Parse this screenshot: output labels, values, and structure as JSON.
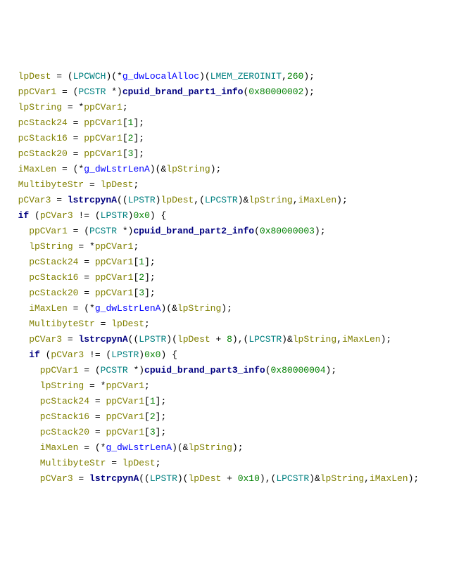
{
  "lines": [
    [
      {
        "t": "  lpDest ",
        "c": "olive"
      },
      {
        "t": "= (",
        "c": "black"
      },
      {
        "t": "LPCWCH",
        "c": "teal"
      },
      {
        "t": ")(*",
        "c": "black"
      },
      {
        "t": "g_dwLocalAlloc",
        "c": "blue"
      },
      {
        "t": ")(",
        "c": "black"
      },
      {
        "t": "LMEM_ZEROINIT",
        "c": "teal"
      },
      {
        "t": ",",
        "c": "black"
      },
      {
        "t": "260",
        "c": "green"
      },
      {
        "t": ");",
        "c": "black"
      }
    ],
    [
      {
        "t": "  ppCVar1 ",
        "c": "olive"
      },
      {
        "t": "= (",
        "c": "black"
      },
      {
        "t": "PCSTR ",
        "c": "teal"
      },
      {
        "t": "*)",
        "c": "black"
      },
      {
        "t": "cpuid_brand_part1_info",
        "c": "navy"
      },
      {
        "t": "(",
        "c": "black"
      },
      {
        "t": "0x80000002",
        "c": "green"
      },
      {
        "t": ");",
        "c": "black"
      }
    ],
    [
      {
        "t": "  lpString ",
        "c": "olive"
      },
      {
        "t": "= *",
        "c": "black"
      },
      {
        "t": "ppCVar1",
        "c": "olive"
      },
      {
        "t": ";",
        "c": "black"
      }
    ],
    [
      {
        "t": "  pcStack24 ",
        "c": "olive"
      },
      {
        "t": "= ",
        "c": "black"
      },
      {
        "t": "ppCVar1",
        "c": "olive"
      },
      {
        "t": "[",
        "c": "black"
      },
      {
        "t": "1",
        "c": "green"
      },
      {
        "t": "];",
        "c": "black"
      }
    ],
    [
      {
        "t": "  pcStack16 ",
        "c": "olive"
      },
      {
        "t": "= ",
        "c": "black"
      },
      {
        "t": "ppCVar1",
        "c": "olive"
      },
      {
        "t": "[",
        "c": "black"
      },
      {
        "t": "2",
        "c": "green"
      },
      {
        "t": "];",
        "c": "black"
      }
    ],
    [
      {
        "t": "  pcStack20 ",
        "c": "olive"
      },
      {
        "t": "= ",
        "c": "black"
      },
      {
        "t": "ppCVar1",
        "c": "olive"
      },
      {
        "t": "[",
        "c": "black"
      },
      {
        "t": "3",
        "c": "green"
      },
      {
        "t": "];",
        "c": "black"
      }
    ],
    [
      {
        "t": "  iMaxLen ",
        "c": "olive"
      },
      {
        "t": "= (*",
        "c": "black"
      },
      {
        "t": "g_dwLstrLenA",
        "c": "blue"
      },
      {
        "t": ")(&",
        "c": "black"
      },
      {
        "t": "lpString",
        "c": "olive"
      },
      {
        "t": ");",
        "c": "black"
      }
    ],
    [
      {
        "t": "  MultibyteStr ",
        "c": "olive"
      },
      {
        "t": "= ",
        "c": "black"
      },
      {
        "t": "lpDest",
        "c": "olive"
      },
      {
        "t": ";",
        "c": "black"
      }
    ],
    [
      {
        "t": "  pCVar3 ",
        "c": "olive"
      },
      {
        "t": "= ",
        "c": "black"
      },
      {
        "t": "lstrcpynA",
        "c": "navy"
      },
      {
        "t": "((",
        "c": "black"
      },
      {
        "t": "LPSTR",
        "c": "teal"
      },
      {
        "t": ")",
        "c": "black"
      },
      {
        "t": "lpDest",
        "c": "olive"
      },
      {
        "t": ",(",
        "c": "black"
      },
      {
        "t": "LPCSTR",
        "c": "teal"
      },
      {
        "t": ")&",
        "c": "black"
      },
      {
        "t": "lpString",
        "c": "olive"
      },
      {
        "t": ",",
        "c": "black"
      },
      {
        "t": "iMaxLen",
        "c": "olive"
      },
      {
        "t": ");",
        "c": "black"
      }
    ],
    [
      {
        "t": "  if ",
        "c": "navy"
      },
      {
        "t": "(",
        "c": "black"
      },
      {
        "t": "pCVar3 ",
        "c": "olive"
      },
      {
        "t": "!= (",
        "c": "black"
      },
      {
        "t": "LPSTR",
        "c": "teal"
      },
      {
        "t": ")",
        "c": "black"
      },
      {
        "t": "0x0",
        "c": "green"
      },
      {
        "t": ") {",
        "c": "black"
      }
    ],
    [
      {
        "t": "    ppCVar1 ",
        "c": "olive"
      },
      {
        "t": "= (",
        "c": "black"
      },
      {
        "t": "PCSTR ",
        "c": "teal"
      },
      {
        "t": "*)",
        "c": "black"
      },
      {
        "t": "cpuid_brand_part2_info",
        "c": "navy"
      },
      {
        "t": "(",
        "c": "black"
      },
      {
        "t": "0x80000003",
        "c": "green"
      },
      {
        "t": ");",
        "c": "black"
      }
    ],
    [
      {
        "t": "    lpString ",
        "c": "olive"
      },
      {
        "t": "= *",
        "c": "black"
      },
      {
        "t": "ppCVar1",
        "c": "olive"
      },
      {
        "t": ";",
        "c": "black"
      }
    ],
    [
      {
        "t": "    pcStack24 ",
        "c": "olive"
      },
      {
        "t": "= ",
        "c": "black"
      },
      {
        "t": "ppCVar1",
        "c": "olive"
      },
      {
        "t": "[",
        "c": "black"
      },
      {
        "t": "1",
        "c": "green"
      },
      {
        "t": "];",
        "c": "black"
      }
    ],
    [
      {
        "t": "    pcStack16 ",
        "c": "olive"
      },
      {
        "t": "= ",
        "c": "black"
      },
      {
        "t": "ppCVar1",
        "c": "olive"
      },
      {
        "t": "[",
        "c": "black"
      },
      {
        "t": "2",
        "c": "green"
      },
      {
        "t": "];",
        "c": "black"
      }
    ],
    [
      {
        "t": "    pcStack20 ",
        "c": "olive"
      },
      {
        "t": "= ",
        "c": "black"
      },
      {
        "t": "ppCVar1",
        "c": "olive"
      },
      {
        "t": "[",
        "c": "black"
      },
      {
        "t": "3",
        "c": "green"
      },
      {
        "t": "];",
        "c": "black"
      }
    ],
    [
      {
        "t": "    iMaxLen ",
        "c": "olive"
      },
      {
        "t": "= (*",
        "c": "black"
      },
      {
        "t": "g_dwLstrLenA",
        "c": "blue"
      },
      {
        "t": ")(&",
        "c": "black"
      },
      {
        "t": "lpString",
        "c": "olive"
      },
      {
        "t": ");",
        "c": "black"
      }
    ],
    [
      {
        "t": "    MultibyteStr ",
        "c": "olive"
      },
      {
        "t": "= ",
        "c": "black"
      },
      {
        "t": "lpDest",
        "c": "olive"
      },
      {
        "t": ";",
        "c": "black"
      }
    ],
    [
      {
        "t": "    pCVar3 ",
        "c": "olive"
      },
      {
        "t": "= ",
        "c": "black"
      },
      {
        "t": "lstrcpynA",
        "c": "navy"
      },
      {
        "t": "((",
        "c": "black"
      },
      {
        "t": "LPSTR",
        "c": "teal"
      },
      {
        "t": ")(",
        "c": "black"
      },
      {
        "t": "lpDest ",
        "c": "olive"
      },
      {
        "t": "+ ",
        "c": "black"
      },
      {
        "t": "8",
        "c": "green"
      },
      {
        "t": "),(",
        "c": "black"
      },
      {
        "t": "LPCSTR",
        "c": "teal"
      },
      {
        "t": ")&",
        "c": "black"
      },
      {
        "t": "lpString",
        "c": "olive"
      },
      {
        "t": ",",
        "c": "black"
      },
      {
        "t": "iMaxLen",
        "c": "olive"
      },
      {
        "t": ");",
        "c": "black"
      }
    ],
    [
      {
        "t": "    if ",
        "c": "navy"
      },
      {
        "t": "(",
        "c": "black"
      },
      {
        "t": "pCVar3 ",
        "c": "olive"
      },
      {
        "t": "!= (",
        "c": "black"
      },
      {
        "t": "LPSTR",
        "c": "teal"
      },
      {
        "t": ")",
        "c": "black"
      },
      {
        "t": "0x0",
        "c": "green"
      },
      {
        "t": ") {",
        "c": "black"
      }
    ],
    [
      {
        "t": "      ppCVar1 ",
        "c": "olive"
      },
      {
        "t": "= (",
        "c": "black"
      },
      {
        "t": "PCSTR ",
        "c": "teal"
      },
      {
        "t": "*)",
        "c": "black"
      },
      {
        "t": "cpuid_brand_part3_info",
        "c": "navy"
      },
      {
        "t": "(",
        "c": "black"
      },
      {
        "t": "0x80000004",
        "c": "green"
      },
      {
        "t": ");",
        "c": "black"
      }
    ],
    [
      {
        "t": "      lpString ",
        "c": "olive"
      },
      {
        "t": "= *",
        "c": "black"
      },
      {
        "t": "ppCVar1",
        "c": "olive"
      },
      {
        "t": ";",
        "c": "black"
      }
    ],
    [
      {
        "t": "      pcStack24 ",
        "c": "olive"
      },
      {
        "t": "= ",
        "c": "black"
      },
      {
        "t": "ppCVar1",
        "c": "olive"
      },
      {
        "t": "[",
        "c": "black"
      },
      {
        "t": "1",
        "c": "green"
      },
      {
        "t": "];",
        "c": "black"
      }
    ],
    [
      {
        "t": "      pcStack16 ",
        "c": "olive"
      },
      {
        "t": "= ",
        "c": "black"
      },
      {
        "t": "ppCVar1",
        "c": "olive"
      },
      {
        "t": "[",
        "c": "black"
      },
      {
        "t": "2",
        "c": "green"
      },
      {
        "t": "];",
        "c": "black"
      }
    ],
    [
      {
        "t": "      pcStack20 ",
        "c": "olive"
      },
      {
        "t": "= ",
        "c": "black"
      },
      {
        "t": "ppCVar1",
        "c": "olive"
      },
      {
        "t": "[",
        "c": "black"
      },
      {
        "t": "3",
        "c": "green"
      },
      {
        "t": "];",
        "c": "black"
      }
    ],
    [
      {
        "t": "      iMaxLen ",
        "c": "olive"
      },
      {
        "t": "= (*",
        "c": "black"
      },
      {
        "t": "g_dwLstrLenA",
        "c": "blue"
      },
      {
        "t": ")(&",
        "c": "black"
      },
      {
        "t": "lpString",
        "c": "olive"
      },
      {
        "t": ");",
        "c": "black"
      }
    ],
    [
      {
        "t": "      MultibyteStr ",
        "c": "olive"
      },
      {
        "t": "= ",
        "c": "black"
      },
      {
        "t": "lpDest",
        "c": "olive"
      },
      {
        "t": ";",
        "c": "black"
      }
    ],
    [
      {
        "t": "      pCVar3 ",
        "c": "olive"
      },
      {
        "t": "= ",
        "c": "black"
      },
      {
        "t": "lstrcpynA",
        "c": "navy"
      },
      {
        "t": "((",
        "c": "black"
      },
      {
        "t": "LPSTR",
        "c": "teal"
      },
      {
        "t": ")(",
        "c": "black"
      },
      {
        "t": "lpDest ",
        "c": "olive"
      },
      {
        "t": "+ ",
        "c": "black"
      },
      {
        "t": "0x10",
        "c": "green"
      },
      {
        "t": "),(",
        "c": "black"
      },
      {
        "t": "LPCSTR",
        "c": "teal"
      },
      {
        "t": ")&",
        "c": "black"
      },
      {
        "t": "lpString",
        "c": "olive"
      },
      {
        "t": ",",
        "c": "black"
      },
      {
        "t": "iMaxLen",
        "c": "olive"
      },
      {
        "t": ");",
        "c": "black"
      }
    ]
  ]
}
